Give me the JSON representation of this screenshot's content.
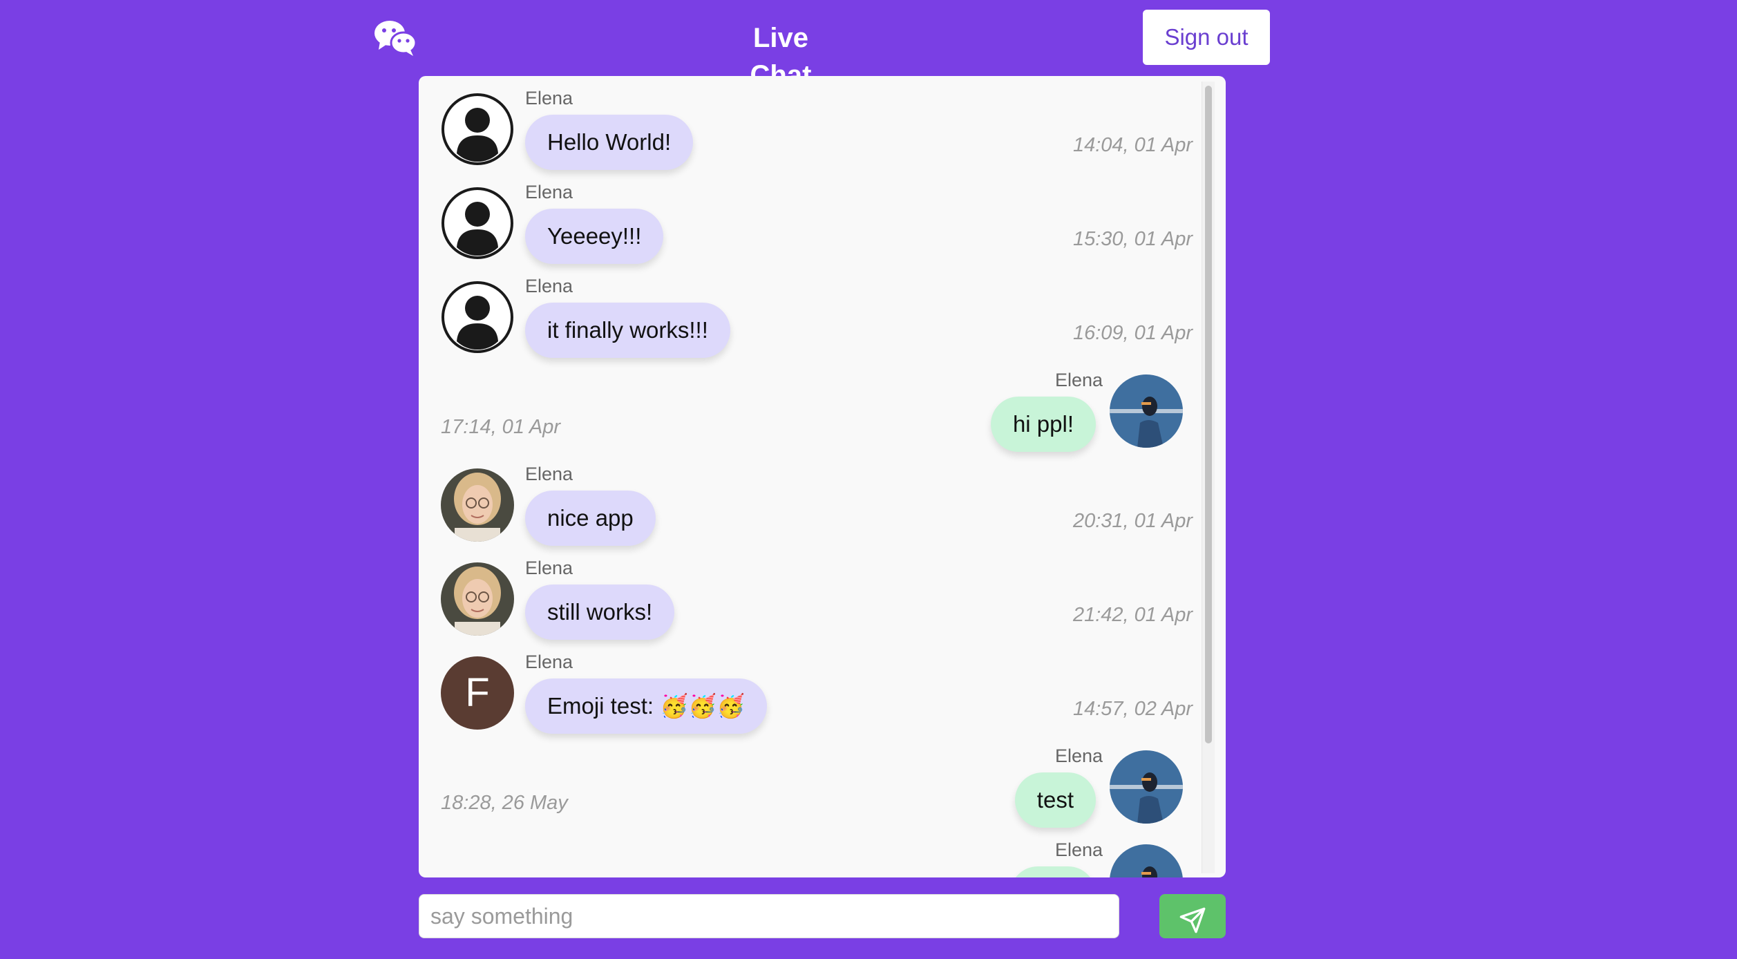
{
  "header": {
    "title": "Live Chat",
    "signout_label": "Sign out",
    "logo_icon": "wechat-icon"
  },
  "composer": {
    "placeholder": "say something",
    "send_icon": "paper-plane-icon"
  },
  "colors": {
    "background": "#7a3fe4",
    "incoming_bubble": "#ddd9fb",
    "outgoing_bubble": "#c8f4d8",
    "send_button": "#5ec26a"
  },
  "messages": [
    {
      "sender": "Elena",
      "text": "Hello World!",
      "time": "14:04, 01 Apr",
      "side": "left",
      "avatar": "default-user-icon"
    },
    {
      "sender": "Elena",
      "text": "Yeeeey!!!",
      "time": "15:30, 01 Apr",
      "side": "left",
      "avatar": "default-user-icon"
    },
    {
      "sender": "Elena",
      "text": "it finally works!!!",
      "time": "16:09, 01 Apr",
      "side": "left",
      "avatar": "default-user-icon"
    },
    {
      "sender": "Elena",
      "text": "hi ppl!",
      "time": "17:14, 01 Apr",
      "side": "right",
      "avatar": "photo-avatar-blue"
    },
    {
      "sender": "Elena",
      "text": "nice app",
      "time": "20:31, 01 Apr",
      "side": "left",
      "avatar": "photo-avatar-woman"
    },
    {
      "sender": "Elena",
      "text": "still works!",
      "time": "21:42, 01 Apr",
      "side": "left",
      "avatar": "photo-avatar-woman"
    },
    {
      "sender": "Elena",
      "text": "Emoji test: 🥳🥳🥳",
      "time": "14:57, 02 Apr",
      "side": "left",
      "avatar": "letter-avatar",
      "avatar_letter": "F"
    },
    {
      "sender": "Elena",
      "text": "test",
      "time": "18:28, 26 May",
      "side": "right",
      "avatar": "photo-avatar-blue"
    },
    {
      "sender": "Elena",
      "text": "",
      "time": "",
      "side": "right",
      "avatar": "photo-avatar-blue"
    }
  ]
}
